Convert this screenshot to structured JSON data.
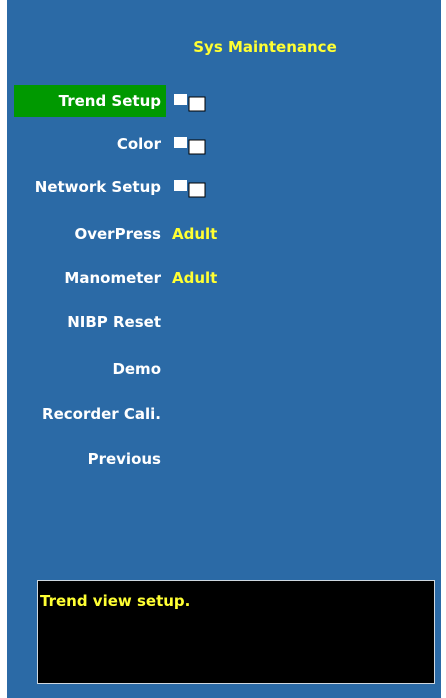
{
  "menu": {
    "title": "Sys Maintenance",
    "items": [
      {
        "label": "Trend Setup",
        "selected": true,
        "submenu_icon": "submenu-pages-icon"
      },
      {
        "label": "Color",
        "submenu_icon": "submenu-pages-icon"
      },
      {
        "label": "Network Setup",
        "submenu_icon": "submenu-pages-icon"
      },
      {
        "label": "OverPress",
        "value": "Adult"
      },
      {
        "label": "Manometer",
        "value": "Adult"
      },
      {
        "label": "NIBP Reset"
      },
      {
        "label": "Demo"
      },
      {
        "label": "Recorder Cali."
      },
      {
        "label": "Previous"
      }
    ]
  },
  "help": {
    "text": "Trend view setup."
  },
  "colors": {
    "panel_bg": "#2b6aa6",
    "selected_bg": "#009900",
    "title_text": "#ffff33",
    "value_text": "#ffff33",
    "item_text": "#ffffff",
    "help_bg": "#000000"
  }
}
